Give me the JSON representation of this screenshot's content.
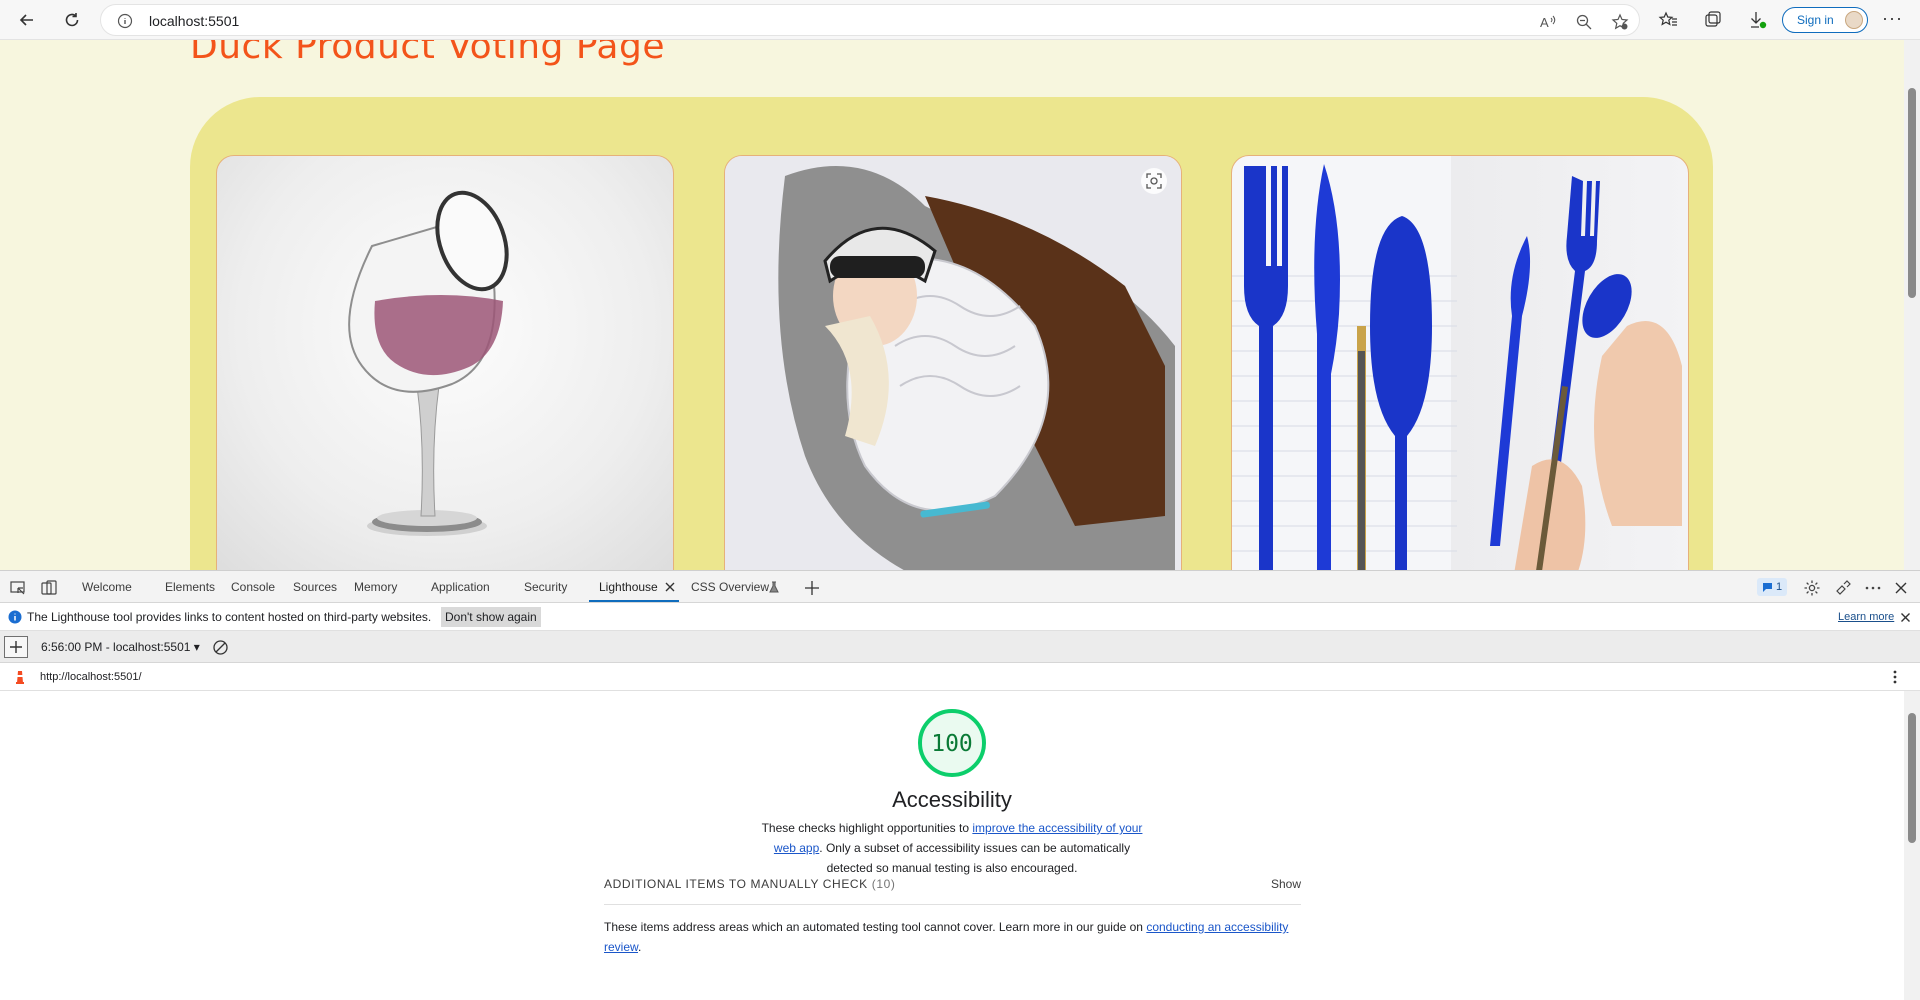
{
  "browser": {
    "url": "localhost:5501",
    "sign_in_label": "Sign in",
    "more_label": "···",
    "icons": [
      "back-icon",
      "refresh-icon",
      "site-info-icon",
      "read-aloud-icon",
      "zoom-icon",
      "add-favorite-icon",
      "favorites-icon",
      "collections-icon",
      "downloads-icon",
      "more-icon"
    ]
  },
  "page": {
    "title": "Duck Product Voting Page",
    "background": "#f7f6de",
    "panel_color": "#ece68e",
    "title_color": "#f3541a",
    "products": [
      {
        "image": "glass-product-image"
      },
      {
        "image": "sleeping-bag-product-image"
      },
      {
        "image": "blue-cutlery-product-image"
      }
    ]
  },
  "devtools": {
    "tabs": [
      {
        "label": "Welcome"
      },
      {
        "label": "Elements"
      },
      {
        "label": "Console"
      },
      {
        "label": "Sources"
      },
      {
        "label": "Memory"
      },
      {
        "label": "Application"
      },
      {
        "label": "Security"
      },
      {
        "label": "Lighthouse",
        "active": true
      },
      {
        "label": "CSS Overview"
      }
    ],
    "issues_count": "1",
    "info_message": "The Lighthouse tool provides links to content hosted on third-party websites.",
    "dont_show_again": "Don't show again",
    "learn_more": "Learn more",
    "report_selector": "6:56:00 PM - localhost:5501",
    "report_url": "http://localhost:5501/",
    "accent_color": "#0f6cbd"
  },
  "lighthouse": {
    "score": 100,
    "score_color": "#0cce6b",
    "category_title": "Accessibility",
    "description_prefix": "These checks highlight opportunities to ",
    "description_link": "improve the accessibility of your web app",
    "description_suffix": ". Only a subset of accessibility issues can be automatically detected so manual testing is also encouraged.",
    "manual_check_title": "ADDITIONAL ITEMS TO MANUALLY CHECK",
    "manual_check_count": "(10)",
    "show_label": "Show",
    "manual_desc_prefix": "These items address areas which an automated testing tool cannot cover. Learn more in our guide on ",
    "manual_desc_link": "conducting an accessibility review",
    "manual_desc_suffix": "."
  }
}
